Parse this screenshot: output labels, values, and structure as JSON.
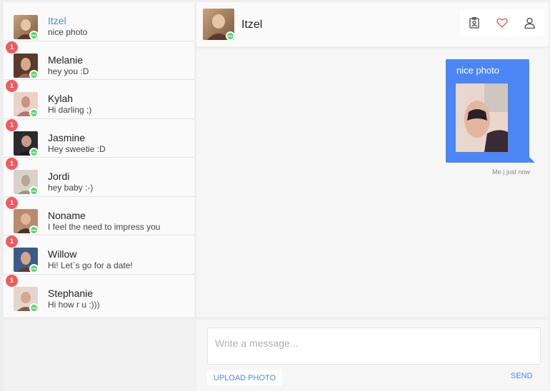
{
  "contacts": [
    {
      "name": "Itzel",
      "message": "nice photo",
      "unread": "",
      "active": true,
      "colors": [
        "#c9a27e",
        "#7a5a3e"
      ]
    },
    {
      "name": "Melanie",
      "message": "hey you :D",
      "unread": "1",
      "active": false,
      "colors": [
        "#5a3a2a",
        "#d8a98a"
      ]
    },
    {
      "name": "Kylah",
      "message": "Hi darling ;)",
      "unread": "1",
      "active": false,
      "colors": [
        "#e8d3c8",
        "#b07a6a"
      ]
    },
    {
      "name": "Jasmine",
      "message": "Hey sweetie :D",
      "unread": "1",
      "active": false,
      "colors": [
        "#2a2a30",
        "#c89a88"
      ]
    },
    {
      "name": "Jordi",
      "message": "hey baby :-)",
      "unread": "1",
      "active": false,
      "colors": [
        "#d9d2cb",
        "#a09080"
      ]
    },
    {
      "name": "Noname",
      "message": "I feel the need to impress you",
      "unread": "1",
      "active": false,
      "colors": [
        "#b88a6e",
        "#4a3326"
      ]
    },
    {
      "name": "Willow",
      "message": "Hi! Let`s go for a date!",
      "unread": "1",
      "active": false,
      "colors": [
        "#3a5c8a",
        "#d7a58a"
      ]
    },
    {
      "name": "Stephanie",
      "message": "Hi how r u :)))",
      "unread": "1",
      "active": false,
      "colors": [
        "#e6d5cc",
        "#8a5a48"
      ]
    }
  ],
  "online_badge": "ONLINE",
  "header": {
    "name": "Itzel",
    "icons": [
      "id-badge-icon",
      "heart-icon",
      "user-icon"
    ],
    "heart_color": "#f25b5b"
  },
  "message": {
    "text": "nice photo",
    "meta": "Me | just now",
    "bubble_color": "#4b86f4"
  },
  "composer": {
    "placeholder": "Write a message...",
    "upload_label": "UPLOAD PHOTO",
    "send_label": "SEND"
  },
  "colors": {
    "accent": "#4b86f4",
    "online": "#4cd964",
    "unread": "#f25b5b"
  }
}
